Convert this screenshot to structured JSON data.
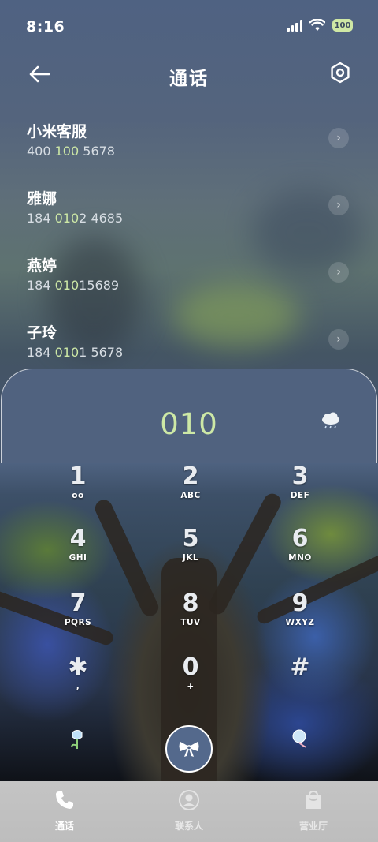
{
  "status": {
    "time": "8:16",
    "battery": "100"
  },
  "header": {
    "title": "通话"
  },
  "contacts": [
    {
      "name": "小米客服",
      "num_pre": "400 ",
      "num_hl": "100",
      "num_post": " 5678"
    },
    {
      "name": "雅娜",
      "num_pre": "184 ",
      "num_hl": "010",
      "num_post": "2 4685"
    },
    {
      "name": "燕婷",
      "num_pre": "184 ",
      "num_hl": "010",
      "num_post": "15689"
    },
    {
      "name": "子玲",
      "num_pre": "184 ",
      "num_hl": "010",
      "num_post": "1 5678"
    }
  ],
  "dialer": {
    "input": "010"
  },
  "keys": [
    {
      "digit": "1",
      "letters": "oo"
    },
    {
      "digit": "2",
      "letters": "ABC"
    },
    {
      "digit": "3",
      "letters": "DEF"
    },
    {
      "digit": "4",
      "letters": "GHI"
    },
    {
      "digit": "5",
      "letters": "JKL"
    },
    {
      "digit": "6",
      "letters": "MNO"
    },
    {
      "digit": "7",
      "letters": "PQRS"
    },
    {
      "digit": "8",
      "letters": "TUV"
    },
    {
      "digit": "9",
      "letters": "WXYZ"
    },
    {
      "digit": "✱",
      "letters": ","
    },
    {
      "digit": "0",
      "letters": "+"
    },
    {
      "digit": "#",
      "letters": ""
    }
  ],
  "nav": {
    "calls": "通话",
    "contacts": "联系人",
    "service": "营业厅"
  },
  "colors": {
    "accent_green": "#cde8a6",
    "panel": "#50627f",
    "call_button": "#54698c"
  }
}
